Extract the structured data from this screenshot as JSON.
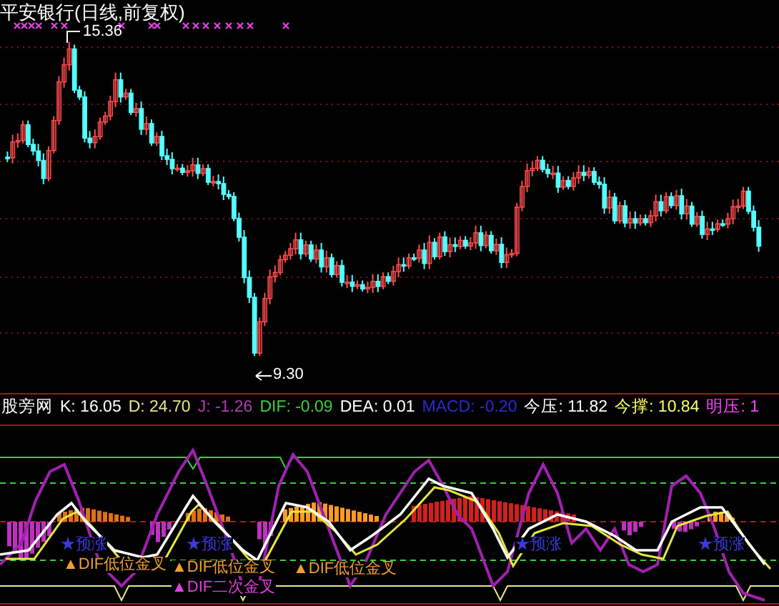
{
  "title": "平安银行(日线,前复权)",
  "price_labels": [
    {
      "kind": "high",
      "text": "15.36"
    },
    {
      "kind": "low",
      "text": "9.30"
    }
  ],
  "indicator": {
    "name": "股旁网",
    "readings": [
      {
        "label": "K:",
        "value": "16.05",
        "color": "#ffffff"
      },
      {
        "label": "D:",
        "value": "24.70",
        "color": "#e6e68a"
      },
      {
        "label": "J:",
        "value": "-1.26",
        "color": "#b03cb0"
      },
      {
        "label": "DIF:",
        "value": "-0.09",
        "color": "#3ccf3c"
      },
      {
        "label": "DEA:",
        "value": "0.01",
        "color": "#ffffff"
      },
      {
        "label": "MACD:",
        "value": "-0.20",
        "color": "#2a2ad0"
      },
      {
        "label": "今压:",
        "value": "11.82",
        "color": "#ffffff"
      },
      {
        "label": "今撑:",
        "value": "10.84",
        "color": "#ffff66"
      },
      {
        "label": "明压:",
        "value": "1",
        "color": "#ff44ff"
      }
    ]
  },
  "signals": [
    {
      "kind": "rise",
      "text": "★预涨"
    },
    {
      "kind": "rise",
      "text": "★预涨"
    },
    {
      "kind": "rise",
      "text": "★预涨"
    },
    {
      "kind": "rise",
      "text": "★预涨"
    },
    {
      "kind": "cross",
      "text": "▲DIF低位金叉"
    },
    {
      "kind": "cross",
      "text": "▲DIF低位金叉"
    },
    {
      "kind": "cross",
      "text": "▲DIF低位金叉"
    },
    {
      "kind": "second_cross",
      "text": "▲DIF二次金叉"
    }
  ]
}
